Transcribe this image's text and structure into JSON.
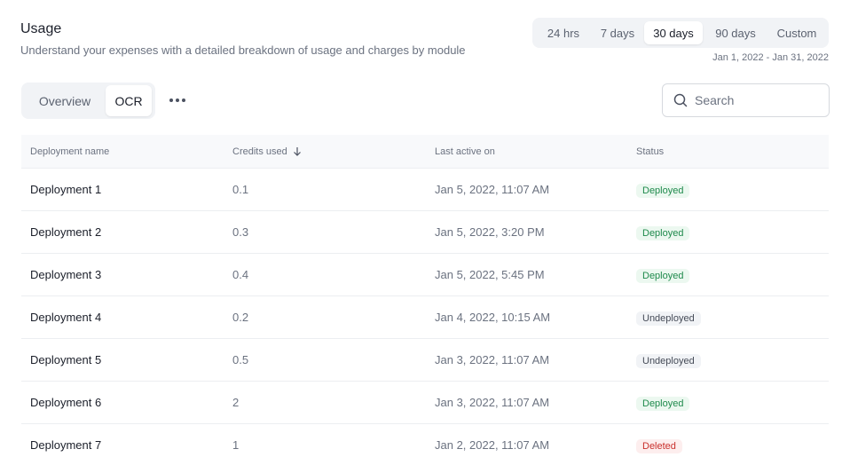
{
  "header": {
    "title": "Usage",
    "subtitle": "Understand your expenses with a detailed breakdown of usage and charges by module"
  },
  "range": {
    "options": [
      "24 hrs",
      "7 days",
      "30 days",
      "90 days",
      "Custom"
    ],
    "selected": "30 days",
    "date_range": "Jan 1, 2022 - Jan 31, 2022"
  },
  "tabs": {
    "items": [
      "Overview",
      "OCR"
    ],
    "active": "OCR"
  },
  "more_icon": "more-horizontal-icon",
  "search": {
    "placeholder": "Search",
    "icon": "search-icon"
  },
  "table": {
    "columns": [
      "Deployment name",
      "Credits used",
      "Last active on",
      "Status"
    ],
    "sort_icon": "arrow-down-icon",
    "rows": [
      {
        "name": "Deployment 1",
        "credits": "0.1",
        "last_active": "Jan 5, 2022, 11:07 AM",
        "status": "Deployed"
      },
      {
        "name": "Deployment 2",
        "credits": "0.3",
        "last_active": "Jan 5, 2022, 3:20 PM",
        "status": "Deployed"
      },
      {
        "name": "Deployment 3",
        "credits": "0.4",
        "last_active": "Jan 5, 2022, 5:45 PM",
        "status": "Deployed"
      },
      {
        "name": "Deployment 4",
        "credits": "0.2",
        "last_active": "Jan 4, 2022, 10:15 AM",
        "status": "Undeployed"
      },
      {
        "name": "Deployment 5",
        "credits": "0.5",
        "last_active": "Jan 3, 2022, 11:07 AM",
        "status": "Undeployed"
      },
      {
        "name": "Deployment 6",
        "credits": "2",
        "last_active": "Jan 3, 2022, 11:07 AM",
        "status": "Deployed"
      },
      {
        "name": "Deployment 7",
        "credits": "1",
        "last_active": "Jan 2, 2022, 11:07 AM",
        "status": "Deleted"
      }
    ]
  },
  "colors": {
    "deployed_bg": "#ecf8f0",
    "deployed_fg": "#1f8a4c",
    "undeployed_bg": "#f1f3f6",
    "undeployed_fg": "#454b57",
    "deleted_bg": "#fdeeee",
    "deleted_fg": "#c9302c"
  }
}
